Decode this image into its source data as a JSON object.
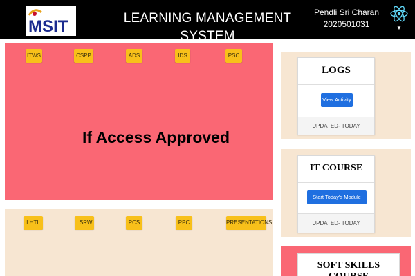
{
  "header": {
    "logo_text": "MSIT",
    "title": "LEARNING MANAGEMENT SYSTEM",
    "user": {
      "name": "Pendli Sri Charan",
      "id": "2020501031"
    },
    "menu_icon": "react-atom-icon",
    "dropdown_icon": "chevron-down-icon"
  },
  "panel_top": {
    "subjects": [
      "ITWS",
      "CSPP",
      "ADS",
      "IDS",
      "PSC"
    ],
    "message": "If Access Approved"
  },
  "panel_bottom": {
    "subjects": [
      "LHTL",
      "LSRW",
      "PCS",
      "PPC",
      "PRESENTATIONS"
    ]
  },
  "cards": [
    {
      "title": "LOGS",
      "button": "View Activity",
      "footer": "UPDATED- TODAY"
    },
    {
      "title": "IT COURSE",
      "button": "Start Today's Module",
      "footer": "UPDATED- TODAY"
    },
    {
      "title": "SOFT SKILLS COURSE"
    }
  ],
  "colors": {
    "header_bg": "#000000",
    "panel_red": "#fa6774",
    "panel_cream": "#f7e6d2",
    "subject_button": "#f8c01a",
    "primary_button": "#1f6fe0",
    "logo_blue": "#1b2b8f",
    "logo_red": "#c8102e",
    "logo_gold": "#e8a21a"
  }
}
